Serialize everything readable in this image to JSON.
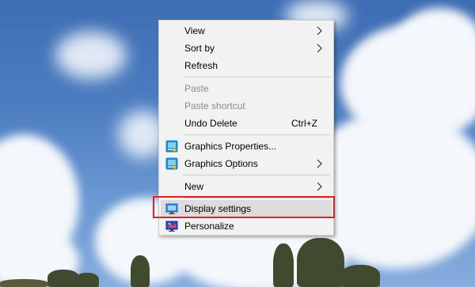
{
  "context_menu": {
    "items": [
      {
        "label": "View",
        "submenu": true,
        "enabled": true
      },
      {
        "label": "Sort by",
        "submenu": true,
        "enabled": true
      },
      {
        "label": "Refresh",
        "enabled": true
      },
      {
        "label": "Paste",
        "enabled": false
      },
      {
        "label": "Paste shortcut",
        "enabled": false
      },
      {
        "label": "Undo Delete",
        "shortcut": "Ctrl+Z",
        "enabled": true
      },
      {
        "label": "Graphics Properties...",
        "icon": "intel-graphics-icon",
        "enabled": true
      },
      {
        "label": "Graphics Options",
        "icon": "intel-graphics-icon",
        "submenu": true,
        "enabled": true
      },
      {
        "label": "New",
        "submenu": true,
        "enabled": true
      },
      {
        "label": "Display settings",
        "icon": "display-icon",
        "enabled": true,
        "highlighted": true
      },
      {
        "label": "Personalize",
        "icon": "personalize-icon",
        "enabled": true
      }
    ]
  },
  "annotation": {
    "color": "#e11f2b",
    "target": "Display settings"
  }
}
